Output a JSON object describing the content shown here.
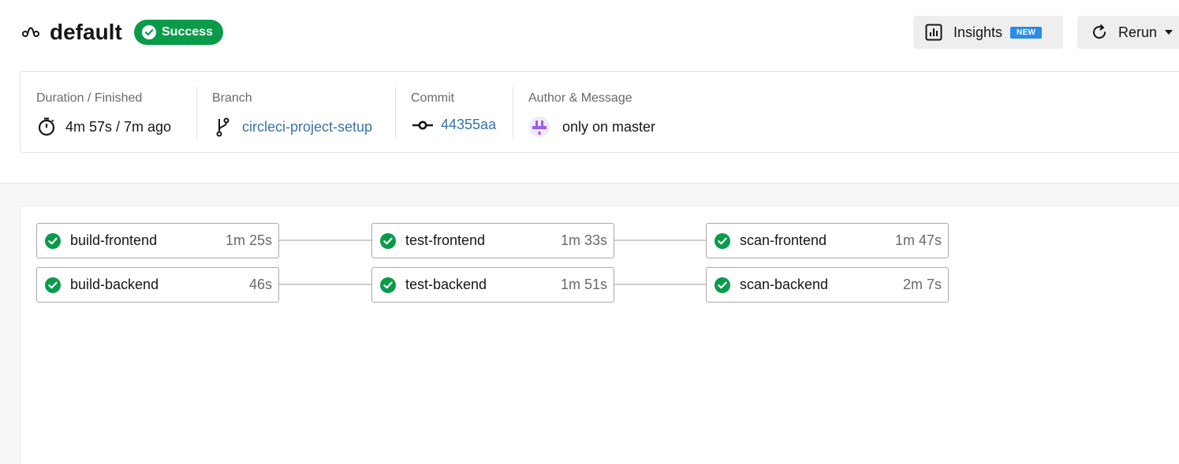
{
  "header": {
    "workflow_icon": "workflow-icon",
    "title": "default",
    "status": "Success",
    "status_color": "#0a9b4a",
    "insights_label": "Insights",
    "insights_badge": "NEW",
    "rerun_label": "Rerun"
  },
  "info": {
    "duration_label": "Duration / Finished",
    "duration_value": "4m 57s / 7m ago",
    "branch_label": "Branch",
    "branch_value": "circleci-project-setup",
    "commit_label": "Commit",
    "commit_value": "44355aa",
    "author_label": "Author & Message",
    "author_message": "only on master"
  },
  "jobs": [
    {
      "name": "build-frontend",
      "duration": "1m 25s",
      "status": "success"
    },
    {
      "name": "test-frontend",
      "duration": "1m 33s",
      "status": "success"
    },
    {
      "name": "scan-frontend",
      "duration": "1m 47s",
      "status": "success"
    },
    {
      "name": "build-backend",
      "duration": "46s",
      "status": "success"
    },
    {
      "name": "test-backend",
      "duration": "1m 51s",
      "status": "success"
    },
    {
      "name": "scan-backend",
      "duration": "2m 7s",
      "status": "success"
    }
  ],
  "colors": {
    "success": "#0a9b4a",
    "link": "#3a73a8",
    "new_badge": "#2b8be6",
    "avatar": "#9b5de5"
  }
}
